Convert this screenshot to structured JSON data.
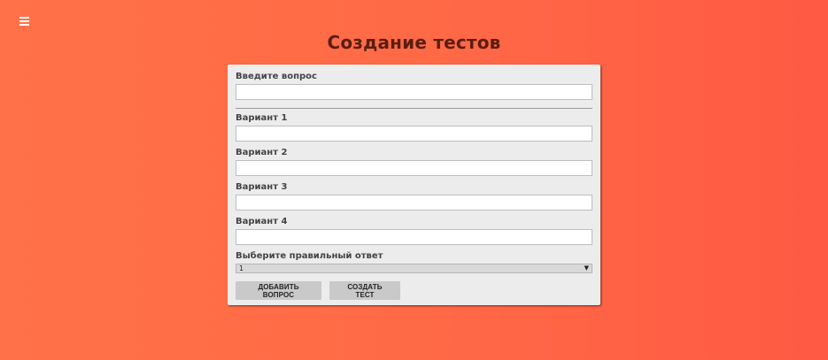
{
  "header": {
    "menu_icon": "hamburger-menu-icon",
    "title": "Создание тестов"
  },
  "form": {
    "question_label": "Введите вопрос",
    "question_value": "",
    "options": [
      {
        "label": "Вариант 1",
        "value": ""
      },
      {
        "label": "Вариант 2",
        "value": ""
      },
      {
        "label": "Вариант 3",
        "value": ""
      },
      {
        "label": "Вариант 4",
        "value": ""
      }
    ],
    "answer_label": "Выберите правильный ответ",
    "answer_selected": "1",
    "answer_arrow_icon": "dropdown-arrow-icon"
  },
  "actions": {
    "add_question_label": "ДОБАВИТЬ ВОПРОС",
    "create_test_label": "СОЗДАТЬ ТЕСТ"
  },
  "colors": {
    "background_start": "#ff7148",
    "background_end": "#ff5a44",
    "card": "#ececec",
    "title": "#5a1e12",
    "button": "#c9c9c9"
  }
}
